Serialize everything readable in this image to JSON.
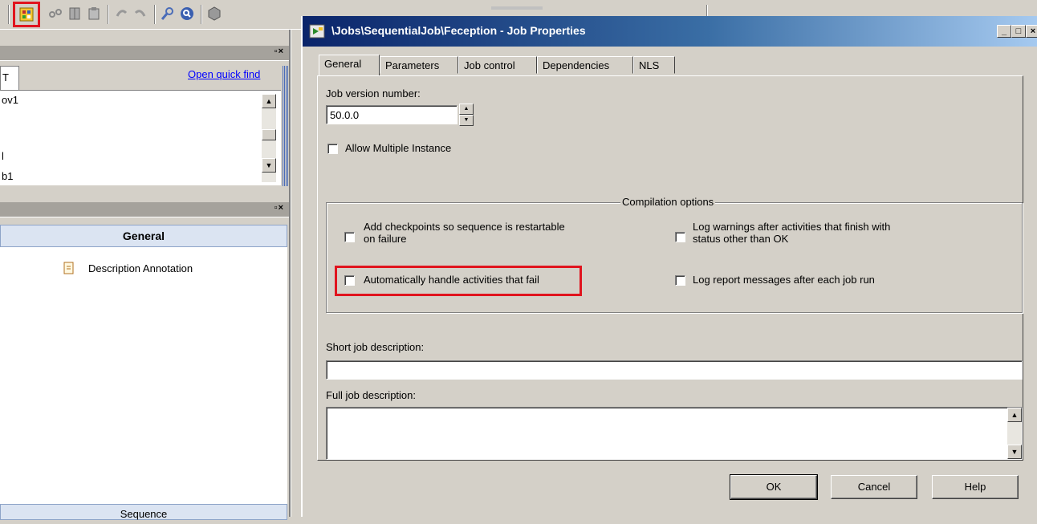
{
  "toolbar": {
    "icons": [
      "toolbar-properties-icon",
      "link-icon",
      "book-icon",
      "clipboard-icon",
      "undo-icon",
      "redo-icon",
      "zoom-icon",
      "search-icon",
      "package-icon"
    ]
  },
  "repository": {
    "tab_label": "T",
    "quick_find": "Open quick find",
    "items": [
      "ov1",
      "",
      "l",
      "b1"
    ]
  },
  "palette": {
    "general_header": "General",
    "items": [
      {
        "label": "Description Annotation",
        "icon": "annotation-icon"
      }
    ],
    "sequence_header": "Sequence"
  },
  "dialog": {
    "title": "\\Jobs\\SequentialJob\\Feception - Job Properties",
    "tabs": [
      {
        "label": "General",
        "active": true
      },
      {
        "label": "Parameters",
        "active": false
      },
      {
        "label": "Job control",
        "active": false
      },
      {
        "label": "Dependencies",
        "active": false
      },
      {
        "label": "NLS",
        "active": false
      }
    ],
    "general": {
      "job_version_label": "Job version number:",
      "job_version_value": "50.0.0",
      "allow_multiple_instance": {
        "label": "Allow Multiple Instance",
        "checked": false
      },
      "compilation_options": {
        "legend": "Compilation options",
        "add_checkpoints": {
          "line1": "Add checkpoints so sequence is restartable",
          "line2": "on failure",
          "checked": false
        },
        "auto_handle": {
          "label": "Automatically handle activities that fail",
          "checked": false
        },
        "log_warnings": {
          "line1": "Log warnings after activities that finish with",
          "line2": "status other than OK",
          "checked": false
        },
        "log_report": {
          "label": "Log report messages after each job run",
          "checked": false
        }
      },
      "short_desc_label": "Short job description:",
      "short_desc_value": "",
      "full_desc_label": "Full job description:",
      "full_desc_value": ""
    },
    "buttons": {
      "ok": "OK",
      "cancel": "Cancel",
      "help": "Help"
    }
  },
  "colors": {
    "highlight": "#e0141e",
    "titlebar_start": "#0a246a",
    "titlebar_end": "#a6caf0"
  }
}
